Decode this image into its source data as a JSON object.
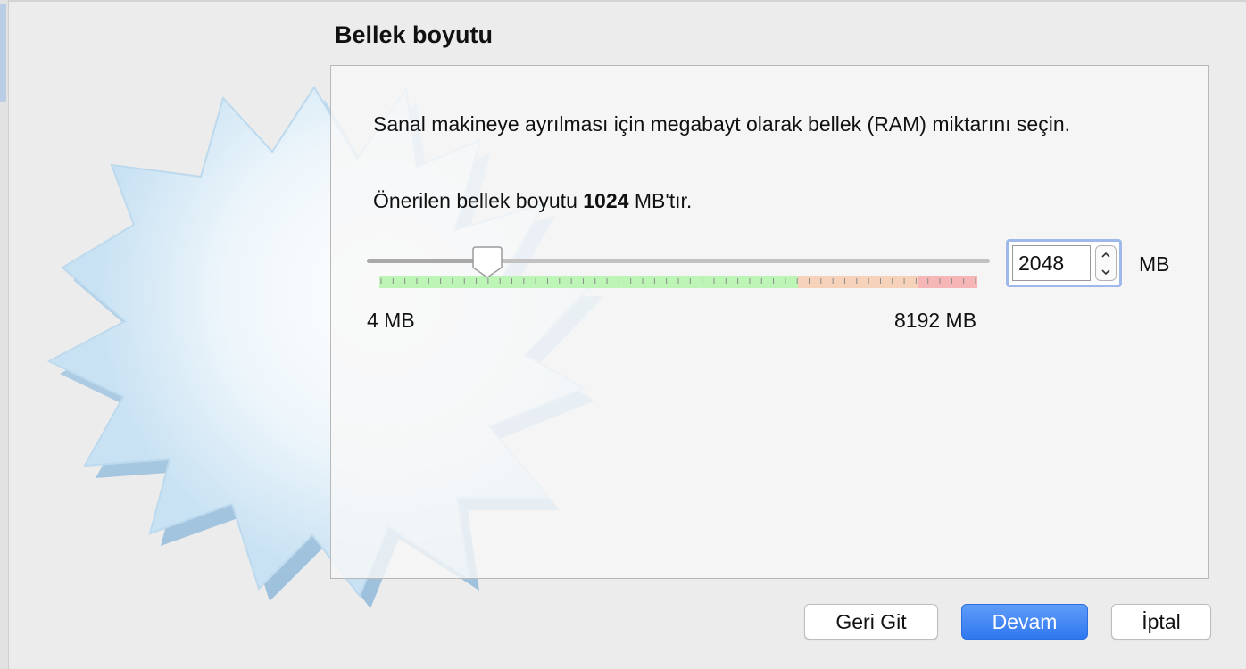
{
  "wizard": {
    "title": "Bellek boyutu",
    "description": "Sanal makineye ayrılması için megabayt olarak bellek (RAM) miktarını seçin.",
    "recommended_prefix": "Önerilen bellek boyutu ",
    "recommended_value": "1024",
    "recommended_suffix": " MB'tır."
  },
  "memory": {
    "slider_value_mb": 2048,
    "min_mb": 4,
    "max_mb": 8192,
    "min_label": "4 MB",
    "max_label": "8192 MB",
    "spin_value": "2048",
    "unit": "MB",
    "range_segments": [
      {
        "name": "safe",
        "fraction": 0.7,
        "color": "#bdf5b7"
      },
      {
        "name": "warning",
        "fraction": 0.2,
        "color": "#f7d2bb"
      },
      {
        "name": "danger",
        "fraction": 0.1,
        "color": "#f6b6b6"
      }
    ]
  },
  "buttons": {
    "back": "Geri Git",
    "next": "Devam",
    "cancel": "İptal"
  },
  "colors": {
    "accent": "#3478f6",
    "background": "#ececec"
  }
}
